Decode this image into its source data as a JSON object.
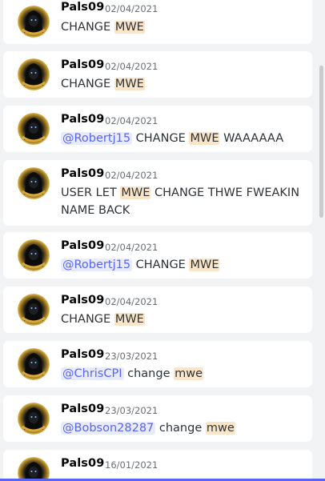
{
  "messages": [
    {
      "author": "Pals09",
      "date": "02/04/2021",
      "parts": [
        {
          "type": "text",
          "text": "CHANGE "
        },
        {
          "type": "hl",
          "text": "MWE"
        }
      ]
    },
    {
      "author": "Pals09",
      "date": "02/04/2021",
      "parts": [
        {
          "type": "text",
          "text": "CHANGE "
        },
        {
          "type": "hl",
          "text": "MWE"
        }
      ]
    },
    {
      "author": "Pals09",
      "date": "02/04/2021",
      "parts": [
        {
          "type": "mention",
          "text": "@Robertj15"
        },
        {
          "type": "text",
          "text": "  CHANGE "
        },
        {
          "type": "hl",
          "text": "MWE"
        },
        {
          "type": "text",
          "text": " WAAAAAA"
        }
      ]
    },
    {
      "author": "Pals09",
      "date": "02/04/2021",
      "parts": [
        {
          "type": "text",
          "text": "USER LET "
        },
        {
          "type": "hl",
          "text": "MWE"
        },
        {
          "type": "text",
          "text": " CHANGE THWE FWEAKIN NAME BACK"
        }
      ]
    },
    {
      "author": "Pals09",
      "date": "02/04/2021",
      "parts": [
        {
          "type": "mention",
          "text": "@Robertj15"
        },
        {
          "type": "text",
          "text": "  CHANGE "
        },
        {
          "type": "hl",
          "text": "MWE"
        }
      ]
    },
    {
      "author": "Pals09",
      "date": "02/04/2021",
      "parts": [
        {
          "type": "text",
          "text": "CHANGE "
        },
        {
          "type": "hl",
          "text": "MWE"
        }
      ]
    },
    {
      "author": "Pals09",
      "date": "23/03/2021",
      "parts": [
        {
          "type": "mention",
          "text": "@ChrisCPI"
        },
        {
          "type": "text",
          "text": " change "
        },
        {
          "type": "hl",
          "text": "mwe"
        }
      ]
    },
    {
      "author": "Pals09",
      "date": "23/03/2021",
      "parts": [
        {
          "type": "mention",
          "text": "@Bobson28287"
        },
        {
          "type": "text",
          "text": " change "
        },
        {
          "type": "hl",
          "text": "mwe"
        }
      ]
    },
    {
      "author": "Pals09",
      "date": "16/01/2021",
      "parts": []
    }
  ],
  "colors": {
    "background": "#f2f3f5",
    "card": "#ffffff",
    "mention_bg": "#e8ebfc",
    "mention_text": "#5865f2",
    "highlight": "#fbe5c8",
    "accent": "#5865f2"
  },
  "icons": {
    "avatar": "dark-hooded-figure-gold-ring-icon"
  }
}
